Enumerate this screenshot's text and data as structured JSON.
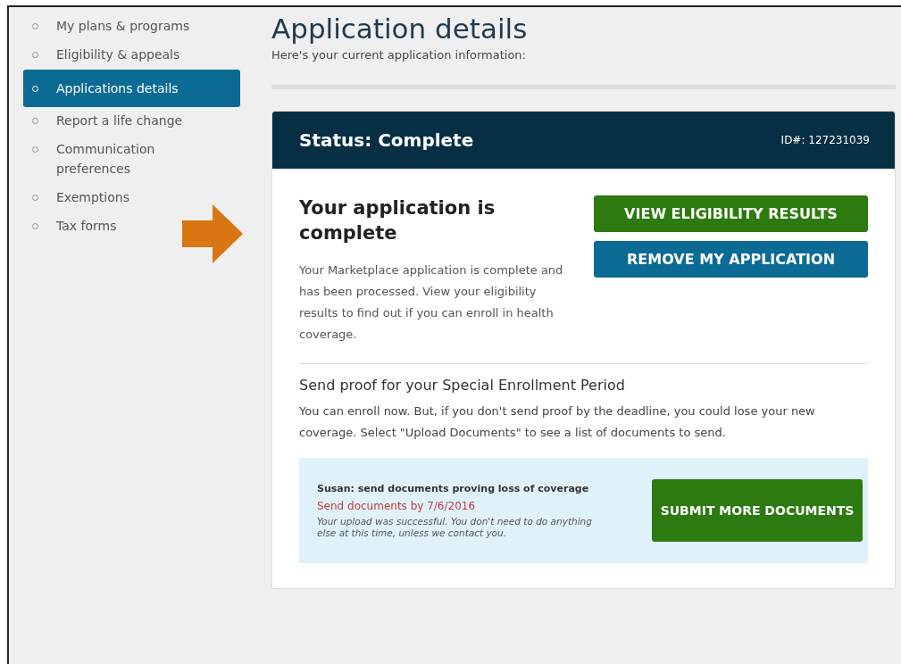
{
  "sidebar": {
    "items": [
      {
        "label": "My plans & programs",
        "selected": false
      },
      {
        "label": "Eligibility & appeals",
        "selected": false
      },
      {
        "label": "Applications details",
        "selected": true
      },
      {
        "label": "Report a life change",
        "selected": false
      },
      {
        "label": "Communication preferences",
        "selected": false
      },
      {
        "label": "Exemptions",
        "selected": false
      },
      {
        "label": "Tax forms",
        "selected": false
      }
    ]
  },
  "page": {
    "title": "Application details",
    "subtitle": "Here's your current application information:"
  },
  "card": {
    "status": "Status: Complete",
    "id": "ID#: 127231039",
    "heading": "Your application is complete",
    "body": "Your Marketplace application is complete and has been processed. View your eligibility results to find out if you can enroll in health coverage.",
    "buttons": [
      {
        "label": "VIEW ELIGIBILITY RESULTS",
        "kind": "primary"
      },
      {
        "label": "REMOVE MY APPLICATION",
        "kind": "secondary"
      }
    ],
    "proof": {
      "heading": "Send proof for your Special Enrollment Period",
      "text": "You can enroll now. But, if you don't send proof by the deadline, you could lose your new coverage. Select \"Upload Documents\" to see a list of documents to send.",
      "task": {
        "title": "Susan: send documents proving loss of coverage",
        "deadline": "Send documents by 7/6/2016",
        "note": "Your upload was successful. You don't need to do anything else at this time, unless we contact you.",
        "button": "SUBMIT MORE DOCUMENTS"
      }
    }
  }
}
